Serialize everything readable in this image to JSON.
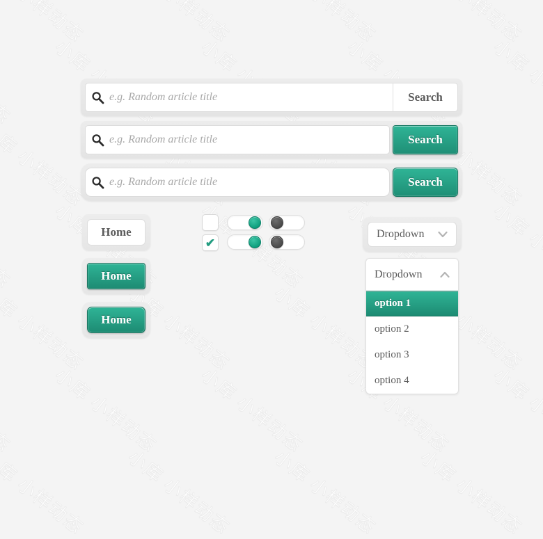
{
  "theme": {
    "background": "#f4f4f4",
    "accent_teal": "#2aa387",
    "accent_teal_dark": "#1d8b73",
    "text_grey": "#5a5a5a",
    "placeholder_grey": "#a8a8a8",
    "toggle_off_grey": "#4a4a4a"
  },
  "watermark": {
    "text": "小库 小样动态"
  },
  "search_bars": [
    {
      "id": "search-bar-plain",
      "icon": "search-icon",
      "value": "",
      "placeholder": "e.g. Random article title",
      "button_label": "Search",
      "button_style": "plain"
    },
    {
      "id": "search-bar-teal-square",
      "icon": "search-icon",
      "value": "",
      "placeholder": "e.g. Random article title",
      "button_label": "Search",
      "button_style": "teal-square"
    },
    {
      "id": "search-bar-teal-rounded",
      "icon": "search-icon",
      "value": "",
      "placeholder": "e.g. Random article title",
      "button_label": "Search",
      "button_style": "teal-rounded"
    }
  ],
  "home_buttons": [
    {
      "id": "home-button-plain",
      "label": "Home",
      "style": "plain"
    },
    {
      "id": "home-button-teal-square",
      "label": "Home",
      "style": "teal-square"
    },
    {
      "id": "home-button-teal-rounded",
      "label": "Home",
      "style": "teal-rounded"
    }
  ],
  "checkboxes": [
    {
      "id": "checkbox-unchecked",
      "checked": false,
      "mark": ""
    },
    {
      "id": "checkbox-checked",
      "checked": true,
      "mark": "✔"
    }
  ],
  "toggles": [
    {
      "id": "toggle-green-top",
      "state": "on",
      "knob_color": "#0e9f7e"
    },
    {
      "id": "toggle-grey-top",
      "state": "off",
      "knob_color": "#4a4a4a"
    },
    {
      "id": "toggle-green-bottom",
      "state": "on",
      "knob_color": "#0e9f7e"
    },
    {
      "id": "toggle-grey-bottom",
      "state": "off",
      "knob_color": "#4a4a4a"
    }
  ],
  "dropdown_closed": {
    "label": "Dropdown",
    "chevron": "chevron-down-icon"
  },
  "dropdown_open": {
    "label": "Dropdown",
    "chevron": "chevron-up-icon",
    "options": [
      {
        "label": "option 1",
        "selected": true
      },
      {
        "label": "option 2",
        "selected": false
      },
      {
        "label": "option 3",
        "selected": false
      },
      {
        "label": "option 4",
        "selected": false
      }
    ]
  }
}
